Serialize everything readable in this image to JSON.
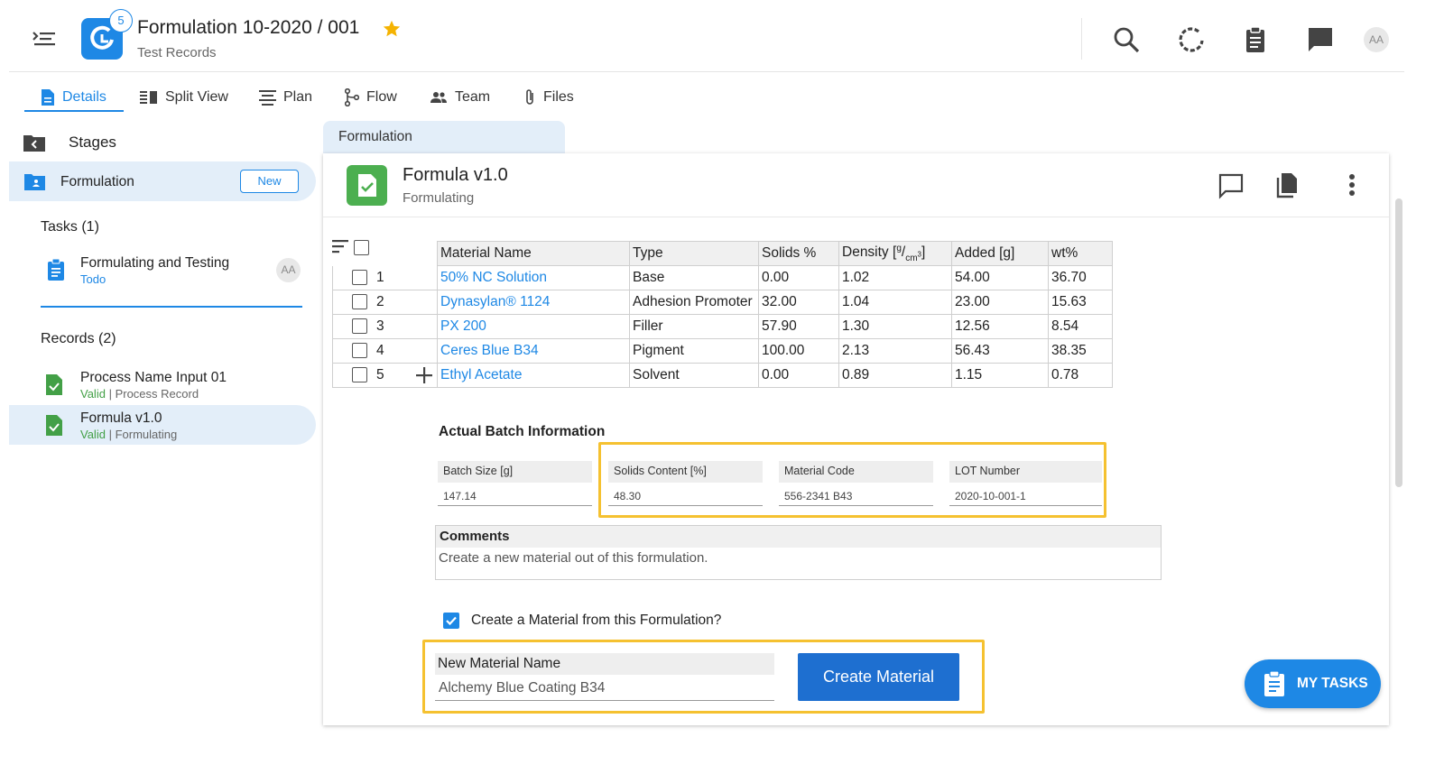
{
  "header": {
    "notification_count": "5",
    "title": "Formulation 10-2020 / 001",
    "subtitle": "Test Records",
    "avatar_initials": "AA",
    "icons": [
      "menu-icon",
      "search-icon",
      "sync-icon",
      "clipboard-icon",
      "chat-icon"
    ],
    "star_color": "#f5b301"
  },
  "tabs": [
    {
      "label": "Details",
      "icon": "document-icon",
      "active": true
    },
    {
      "label": "Split View",
      "icon": "split-view-icon"
    },
    {
      "label": "Plan",
      "icon": "plan-icon"
    },
    {
      "label": "Flow",
      "icon": "flow-icon"
    },
    {
      "label": "Team",
      "icon": "team-icon"
    },
    {
      "label": "Files",
      "icon": "paperclip-icon"
    }
  ],
  "sidebar": {
    "stages_label": "Stages",
    "stage": {
      "label": "Formulation",
      "badge": "New"
    },
    "tasks_heading": "Tasks (1)",
    "task": {
      "title": "Formulating and Testing",
      "status": "Todo",
      "avatar": "AA"
    },
    "records_heading": "Records (2)",
    "records": [
      {
        "title": "Process Name Input 01",
        "status": "Valid",
        "type": "| Process Record"
      },
      {
        "title": "Formula v1.0",
        "status": "Valid",
        "type": "| Formulating"
      }
    ]
  },
  "main": {
    "stage_tab": "Formulation",
    "card_title": "Formula v1.0",
    "card_subtitle": "Formulating",
    "table": {
      "headers": [
        "Material Name",
        "Type",
        "Solids %",
        "Density [g/cm3]",
        "Added [g]",
        "wt%"
      ],
      "density_header": {
        "prefix": "Density [",
        "num": "g",
        "sep": "/",
        "den": "cm",
        "exp": "3",
        "suffix": "]"
      },
      "rows": [
        {
          "num": "1",
          "name": "50% NC Solution",
          "type": "Base",
          "solids": "0.00",
          "density": "1.02",
          "added": "54.00",
          "wt": "36.70"
        },
        {
          "num": "2",
          "name": "Dynasylan® 1124",
          "type": "Adhesion Promoter",
          "solids": "32.00",
          "density": "1.04",
          "added": "23.00",
          "wt": "15.63"
        },
        {
          "num": "3",
          "name": "PX 200",
          "type": "Filler",
          "solids": "57.90",
          "density": "1.30",
          "added": "12.56",
          "wt": "8.54"
        },
        {
          "num": "4",
          "name": "Ceres Blue B34",
          "type": "Pigment",
          "solids": "100.00",
          "density": "2.13",
          "added": "56.43",
          "wt": "38.35"
        },
        {
          "num": "5",
          "name": "Ethyl Acetate",
          "type": "Solvent",
          "solids": "0.00",
          "density": "0.89",
          "added": "1.15",
          "wt": "0.78"
        }
      ]
    },
    "batch": {
      "title": "Actual Batch Information",
      "fields": [
        {
          "label": "Batch Size [g]",
          "value": "147.14"
        },
        {
          "label": "Solids Content [%]",
          "value": "48.30"
        },
        {
          "label": "Material Code",
          "value": "556-2341 B43"
        },
        {
          "label": "LOT Number",
          "value": "2020-10-001-1"
        }
      ]
    },
    "comments": {
      "label": "Comments",
      "text": "Create a new material out of this formulation."
    },
    "create_material_checkbox": {
      "label": "Create a Material from this Formulation?",
      "checked": true
    },
    "new_material": {
      "label": "New Material Name",
      "value": "Alchemy Blue Coating B34",
      "button": "Create Material"
    },
    "highlight_color": "#f5c130"
  },
  "fab": {
    "label": "MY TASKS"
  }
}
